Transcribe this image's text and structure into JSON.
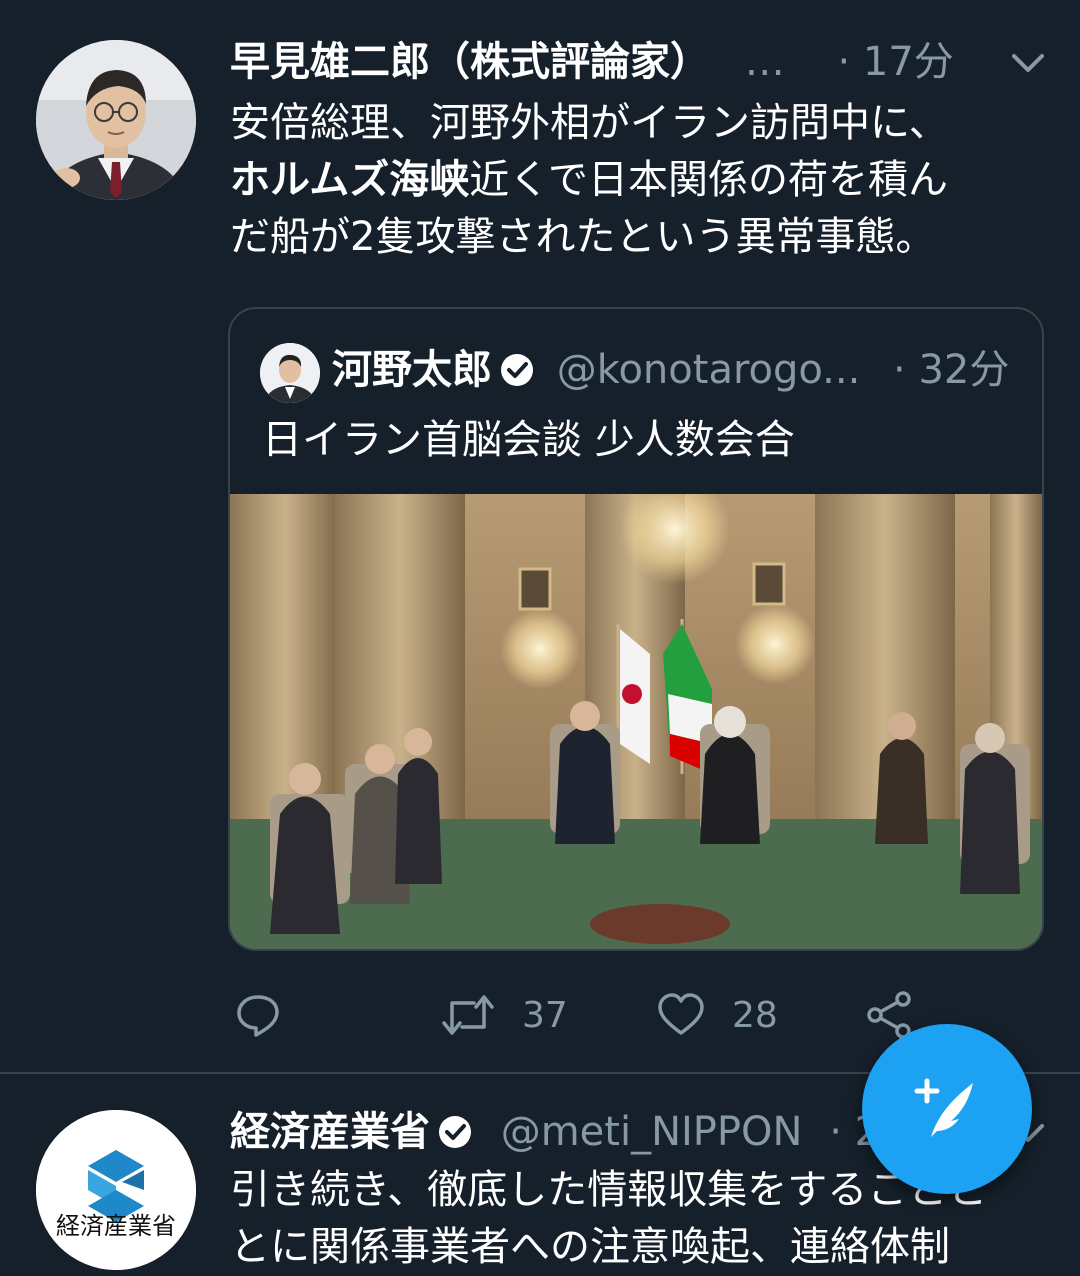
{
  "tweet1": {
    "author_name": "早見雄二郎（株式評論家）",
    "author_handle": "…",
    "time": "· 17分",
    "text_line1": "安倍総理、河野外相がイラン訪問中に、",
    "text_bold": "ホルムズ海峡",
    "text_line2_rest": "近くで日本関係の荷を積ん",
    "text_line3": "だ船が2隻攻撃されたという異常事態。",
    "quote": {
      "author_name": "河野太郎",
      "handle": "@konotarogo...",
      "time": "· 32分",
      "text": "日イラン首脳会談 少人数会合"
    },
    "actions": {
      "reply_count": "",
      "retweet_count": "37",
      "like_count": "28"
    }
  },
  "tweet2": {
    "author_name": "経済産業省",
    "handle": "@meti_NIPPON",
    "time": "· 2",
    "text_line1": "引き続き、徹底した情報収集をすることと",
    "text_line2": "とに関係事業者への注意喚起、連絡体制",
    "avatar_logo_text": "経済産業省"
  },
  "colors": {
    "background": "#15202b",
    "muted": "#8899a6",
    "border": "#38444d",
    "accent": "#1da1f2"
  },
  "icons": [
    "chevron-down-icon",
    "verified-badge-icon",
    "reply-icon",
    "retweet-icon",
    "like-icon",
    "share-icon",
    "compose-icon"
  ]
}
